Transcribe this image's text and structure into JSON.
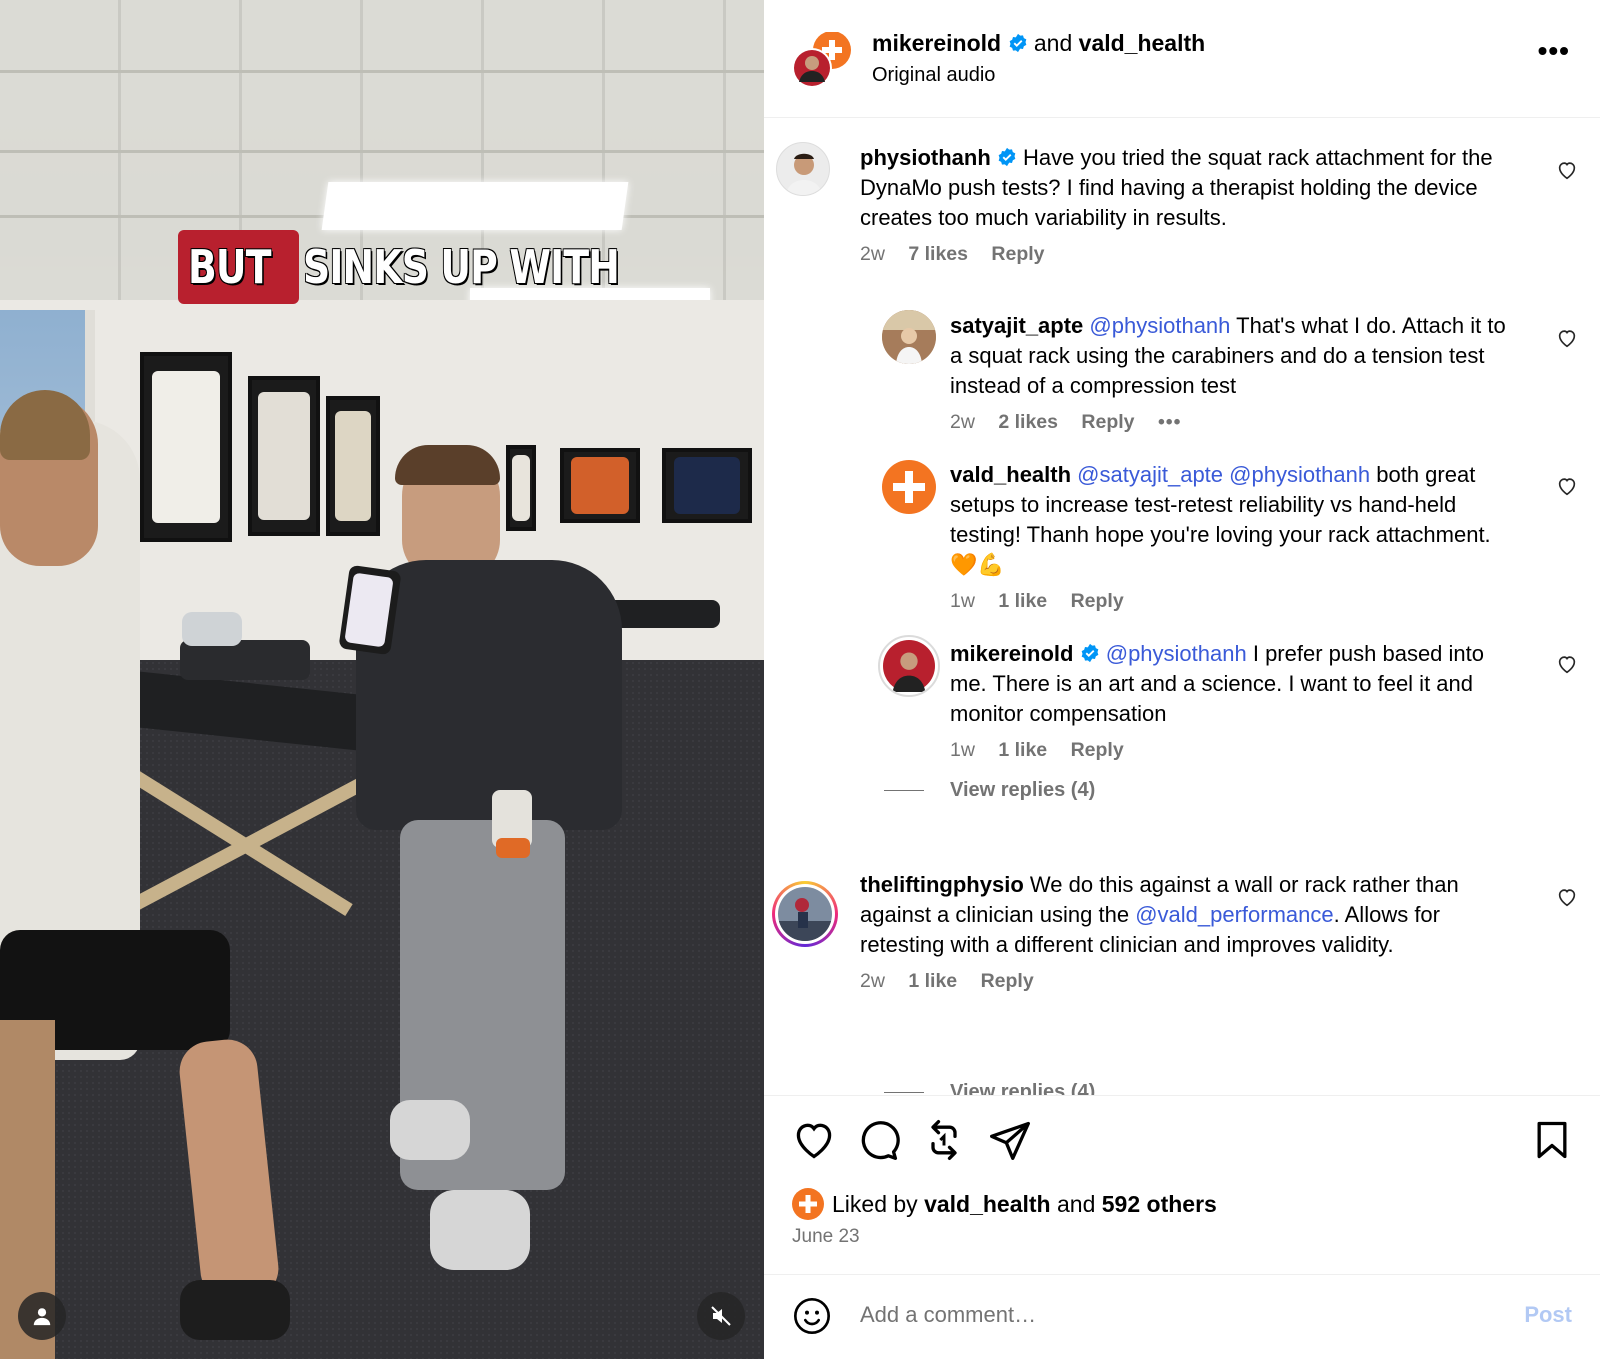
{
  "video": {
    "caption_highlight": "BUT",
    "caption_rest": "SINKS UP WITH",
    "user_icon": "person-icon",
    "mute_icon": "muted-speaker-icon"
  },
  "header": {
    "author": "mikereinold",
    "conjunction": "and",
    "collaborator": "vald_health",
    "audio": "Original audio",
    "more": "•••"
  },
  "comments": [
    {
      "user": "physiothanh",
      "verified": true,
      "text": "Have you tried the squat rack attachment for the DynaMo push tests? I find having a therapist holding the device creates too much variability in results.",
      "time": "2w",
      "likes": "7 likes",
      "reply": "Reply"
    },
    {
      "user": "satyajit_apte",
      "mention": "@physiothanh",
      "text": "That's what I do. Attach it to a squat rack using the carabiners and do a tension test instead of a compression test",
      "time": "2w",
      "likes": "2 likes",
      "reply": "Reply",
      "more": "•••"
    },
    {
      "user": "vald_health",
      "mention": "@satyajit_apte @physiothanh",
      "text": "both great setups to increase test-retest reliability vs hand-held testing! Thanh hope you're loving your rack attachment. 🧡💪",
      "time": "1w",
      "likes": "1 like",
      "reply": "Reply"
    },
    {
      "user": "mikereinold",
      "verified": true,
      "mention": "@physiothanh",
      "text": "I prefer push based into me. There is an art and a science. I want to feel it and monitor compensation",
      "time": "1w",
      "likes": "1 like",
      "reply": "Reply"
    },
    {
      "user": "theliftingphysio",
      "text_before": "We do this against a wall or rack rather than against a clinician using the",
      "mention": "@vald_performance",
      "text_after": ". Allows for retesting with a different clinician and improves validity.",
      "time": "2w",
      "likes": "1 like",
      "reply": "Reply"
    }
  ],
  "view_replies_1": "View replies (4)",
  "view_replies_2": "View replies (4)",
  "actions": {
    "liked_prefix": "Liked by",
    "liked_user": "vald_health",
    "liked_and": "and",
    "liked_others": "592 others",
    "date": "June 23"
  },
  "add_comment": {
    "placeholder": "Add a comment…",
    "post": "Post"
  },
  "colors": {
    "accent_blue": "#0095f6",
    "mention": "#3a5ad8",
    "vald_orange": "#f37421",
    "caption_red": "#b8202e"
  }
}
